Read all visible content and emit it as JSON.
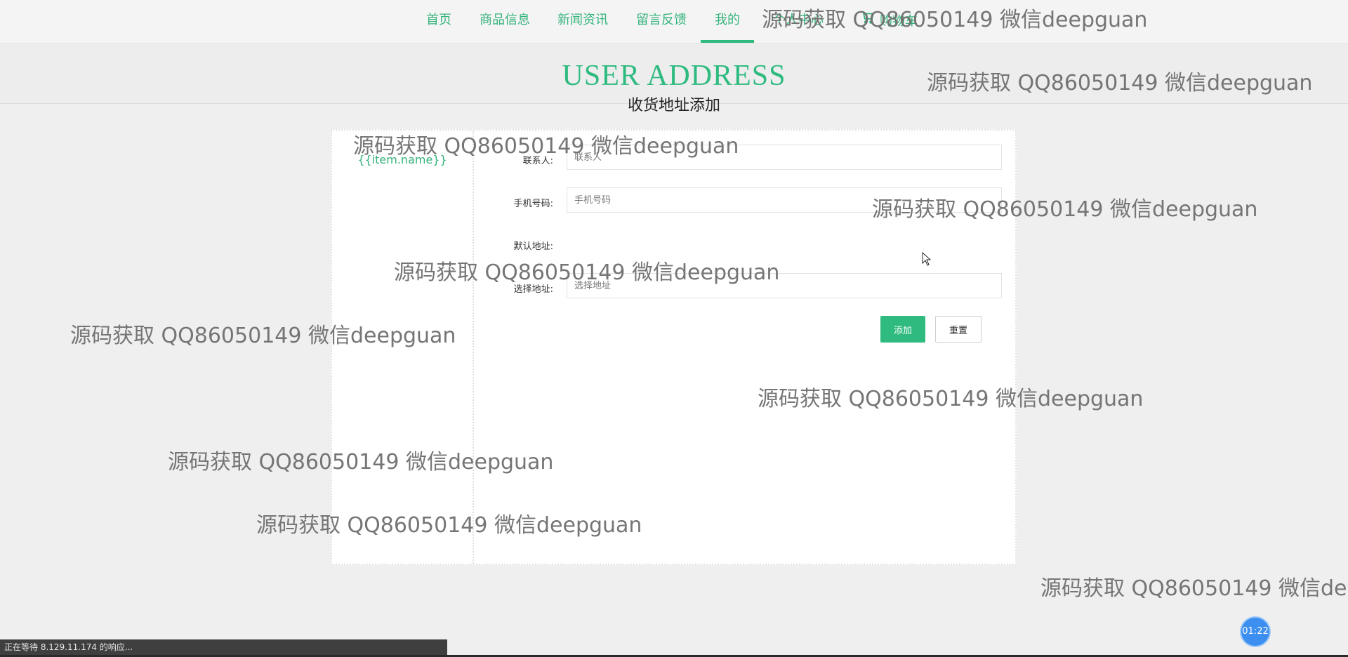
{
  "nav": {
    "items": [
      {
        "label": "首页"
      },
      {
        "label": "商品信息"
      },
      {
        "label": "新闻资讯"
      },
      {
        "label": "留言反馈"
      },
      {
        "label": "我的"
      },
      {
        "label": "个人中心"
      }
    ],
    "cart_label": "购物车",
    "active_item": "我的"
  },
  "header": {
    "title": "USER ADDRESS",
    "subtitle": "收货地址添加"
  },
  "sidebar": {
    "items": [
      {
        "label": "{{item.name}}"
      }
    ]
  },
  "form": {
    "contact": {
      "label": "联系人:",
      "placeholder": "联系人",
      "value": ""
    },
    "phone": {
      "label": "手机号码:",
      "placeholder": "手机号码",
      "value": ""
    },
    "default_address": {
      "label": "默认地址:"
    },
    "address": {
      "label": "选择地址:",
      "placeholder": "选择地址",
      "value": ""
    },
    "add_button": "添加",
    "reset_button": "重置"
  },
  "watermark": {
    "text": "源码获取 QQ86050149 微信deepguan"
  },
  "status_bar": {
    "text": "正在等待 8.129.11.174 的响应..."
  },
  "timer": {
    "text": "01:22"
  },
  "colors": {
    "accent": "#2fbb80",
    "nav_text": "#34b37b",
    "timer": "#3c8ff0"
  }
}
